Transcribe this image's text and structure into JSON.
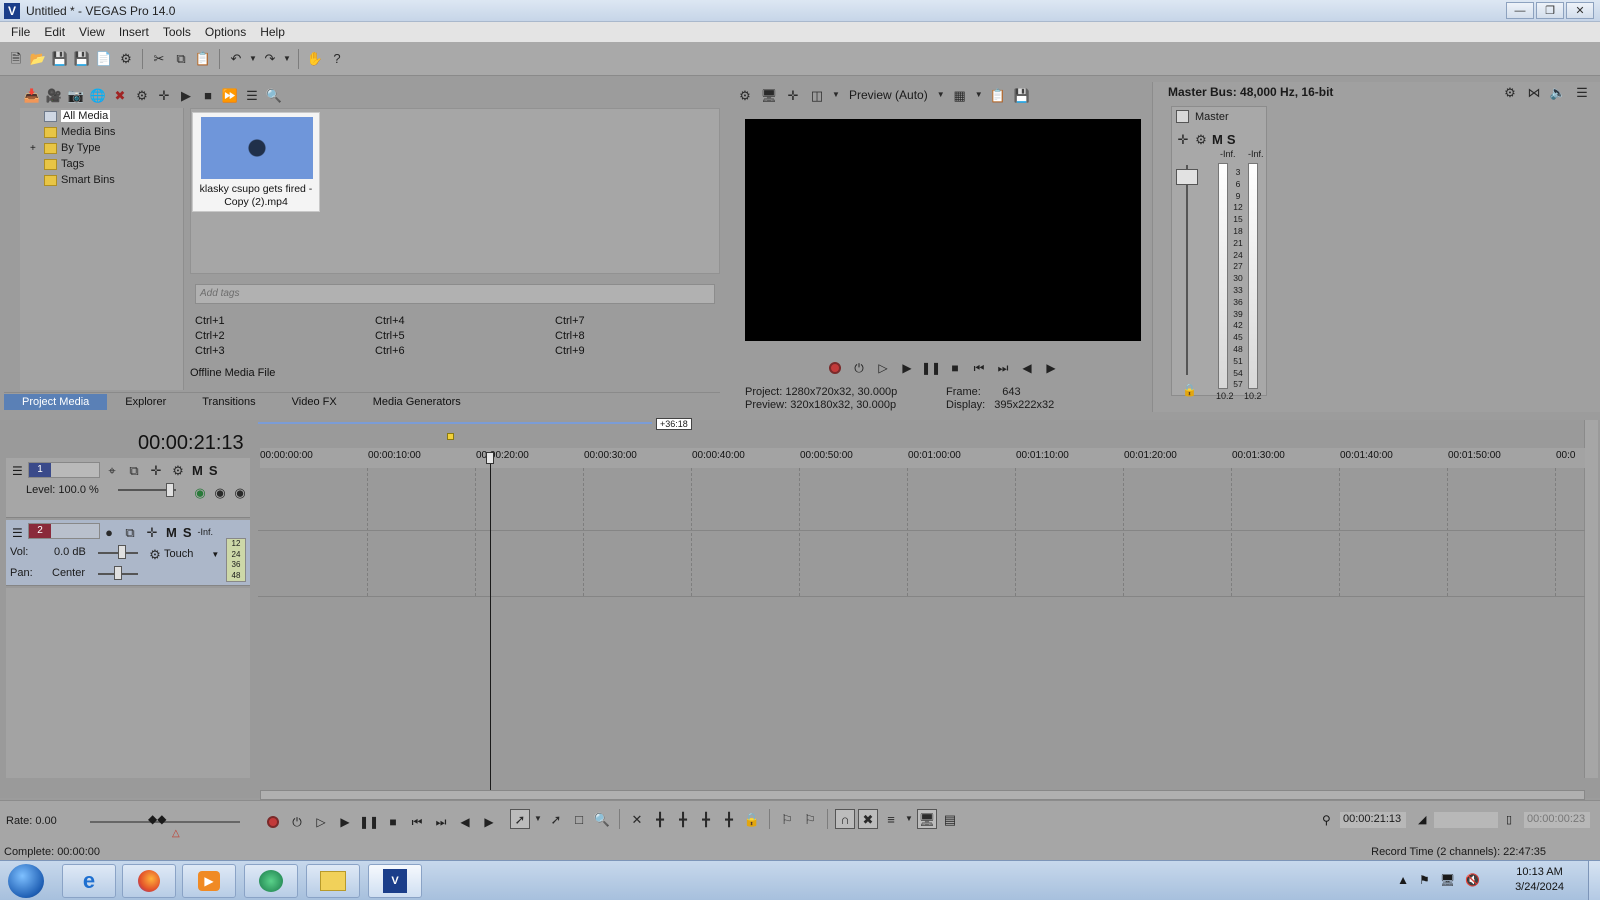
{
  "window": {
    "title": "Untitled * - VEGAS Pro 14.0"
  },
  "menu": [
    "File",
    "Edit",
    "View",
    "Insert",
    "Tools",
    "Options",
    "Help"
  ],
  "media": {
    "tree": [
      "All Media",
      "Media Bins",
      "By Type",
      "Tags",
      "Smart Bins"
    ],
    "file_label": "klasky csupo gets fired - Copy (2).mp4",
    "tags_placeholder": "Add tags",
    "hotkeys": [
      "Ctrl+1",
      "Ctrl+2",
      "Ctrl+3",
      "Ctrl+4",
      "Ctrl+5",
      "Ctrl+6",
      "Ctrl+7",
      "Ctrl+8",
      "Ctrl+9"
    ],
    "status": "Offline Media File",
    "tabs": [
      "Project Media",
      "Explorer",
      "Transitions",
      "Video FX",
      "Media Generators"
    ]
  },
  "preview": {
    "mode": "Preview (Auto)",
    "project_label": "Project:",
    "project_value": "1280x720x32, 30.000p",
    "preview_label": "Preview:",
    "preview_value": "320x180x32, 30.000p",
    "frame_label": "Frame:",
    "frame_value": "643",
    "display_label": "Display:",
    "display_value": "395x222x32"
  },
  "mixer": {
    "title": "Master Bus: 48,000 Hz, 16-bit",
    "master": "Master",
    "m": "M",
    "s": "S",
    "inf": "-Inf.",
    "scale": [
      "3",
      "6",
      "9",
      "12",
      "15",
      "18",
      "21",
      "24",
      "27",
      "30",
      "33",
      "36",
      "39",
      "42",
      "45",
      "48",
      "51",
      "54",
      "57"
    ],
    "peak_l": "10.2",
    "peak_r": "10.2"
  },
  "timeline": {
    "timecode": "00:00:21:13",
    "loop_badge": "+36:18",
    "ruler": [
      "00:00:00:00",
      "00:00:10:00",
      "00:00:20:00",
      "00:00:30:00",
      "00:00:40:00",
      "00:00:50:00",
      "00:01:00:00",
      "00:01:10:00",
      "00:01:20:00",
      "00:01:30:00",
      "00:01:40:00",
      "00:01:50:00",
      "00:0"
    ],
    "track1": {
      "num": "1",
      "level_label": "Level: 100.0 %",
      "m": "M",
      "s": "S"
    },
    "track2": {
      "num": "2",
      "vol_label": "Vol:",
      "vol_value": "0.0 dB",
      "pan_label": "Pan:",
      "pan_value": "Center",
      "touch": "Touch",
      "m": "M",
      "s": "S",
      "inf": "-Inf.",
      "meter": [
        "12",
        "24",
        "36",
        "48"
      ]
    }
  },
  "bottom": {
    "rate": "Rate: 0.00",
    "cursor_time": "00:00:21:13",
    "end_time": "00:00:00:23",
    "complete": "Complete: 00:00:00",
    "record_time": "Record Time (2 channels): 22:47:35"
  },
  "taskbar": {
    "time": "10:13 AM",
    "date": "3/24/2024"
  }
}
